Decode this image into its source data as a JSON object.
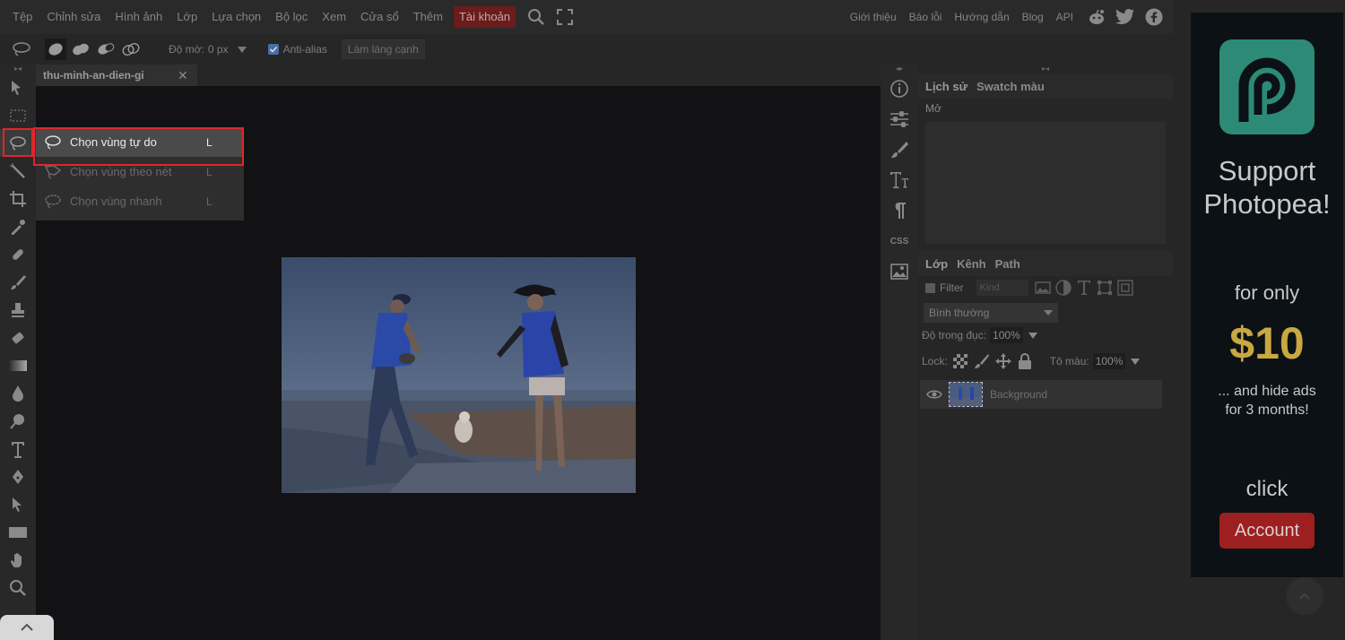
{
  "menubar": {
    "items": [
      "Tệp",
      "Chỉnh sửa",
      "Hình ảnh",
      "Lớp",
      "Lựa chọn",
      "Bộ lọc",
      "Xem",
      "Cửa sổ",
      "Thêm"
    ],
    "account": "Tài khoản",
    "right_items": [
      "Giới thiệu",
      "Báo lỗi",
      "Hướng dẫn",
      "Blog",
      "API"
    ]
  },
  "options": {
    "feather_label": "Độ mờ:",
    "feather_value": "0 px",
    "antialias_label": "Anti-alias",
    "refine_label": "Làm láng cạnh"
  },
  "document": {
    "tab_name": "thu-minh-an-dien-gi",
    "close": "✕"
  },
  "flyout": {
    "items": [
      {
        "label": "Chọn vùng tự do",
        "key": "L"
      },
      {
        "label": "Chọn vùng theo nét",
        "key": "L"
      },
      {
        "label": "Chọn vùng nhanh",
        "key": "L"
      }
    ]
  },
  "iconcol": {
    "css_label": "CSS"
  },
  "history_panel": {
    "tabs": [
      "Lịch sử",
      "Swatch màu"
    ],
    "entries": [
      "Mở"
    ]
  },
  "layers_panel": {
    "tabs": [
      "Lớp",
      "Kênh",
      "Path"
    ],
    "filter_label": "Filter",
    "kind_label": "Kind",
    "blend_mode": "Bình thường",
    "opacity_label": "Độ trong đục:",
    "opacity_value": "100%",
    "lock_label": "Lock:",
    "fill_label": "Tô màu:",
    "fill_value": "100%",
    "layers": [
      {
        "name": "Background"
      }
    ]
  },
  "ad": {
    "title_line1": "Support",
    "title_line2": "Photopea!",
    "for_only": "for only",
    "price": "$10",
    "hide_line1": "... and hide ads",
    "hide_line2": "for 3 months!",
    "click": "click",
    "button": "Account"
  },
  "colors": {
    "highlight": "#e0262a",
    "account_bg": "#6b1c1c",
    "ad_logo": "#2c8a77",
    "ad_price": "#c9a83f",
    "ad_button": "#9e1f1f"
  }
}
